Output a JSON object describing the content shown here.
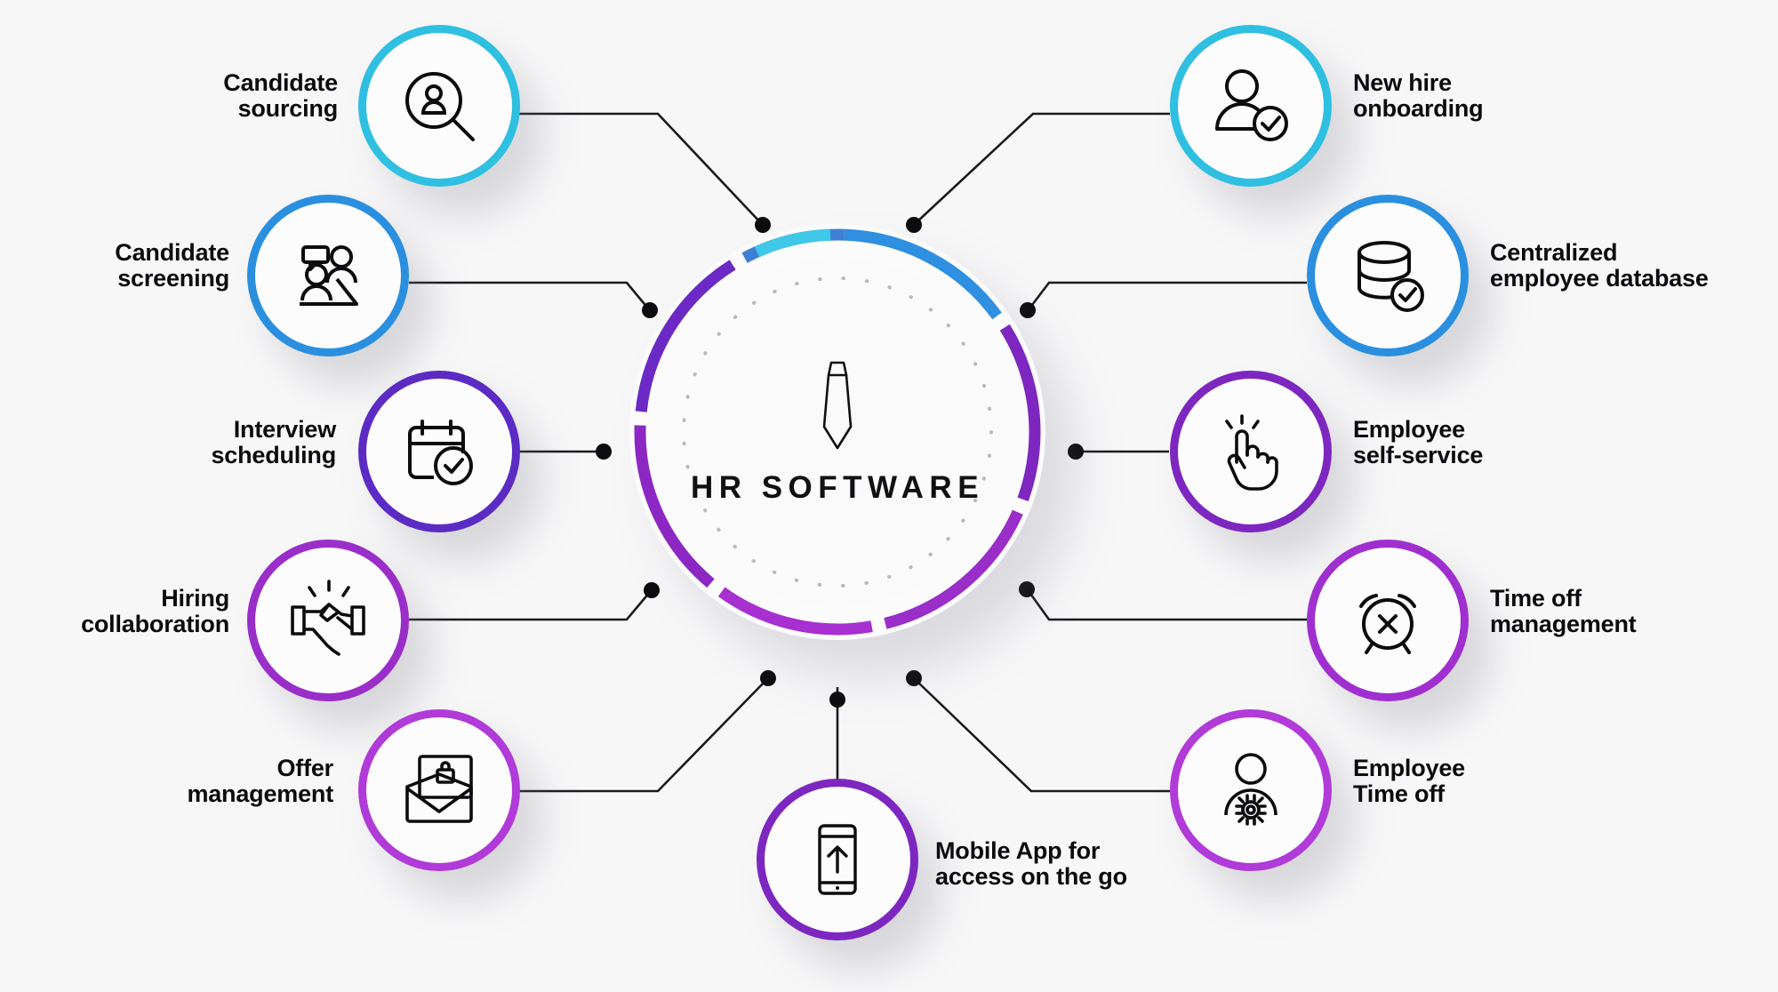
{
  "center": {
    "title": "HR SOFTWARE",
    "icon": "necktie-icon",
    "ring_colors": [
      "#3fc8e8",
      "#2f92e0",
      "#3f7fd6",
      "#5b2bc4",
      "#7d27c0",
      "#9a2ec9",
      "#b03bd8"
    ]
  },
  "palette": {
    "cyan": "#2fbfe0",
    "blue": "#2b8fe0",
    "indigo": "#3c79d0",
    "violet": "#5b2bc4",
    "purple": "#7d27c0",
    "magenta": "#a02fd0",
    "orchid": "#b03bd8",
    "line": "#1a1a1f",
    "text": "#0c0c0f",
    "background": "#f7f7f8"
  },
  "nodes": [
    {
      "id": "candidate-sourcing",
      "label": "Candidate\nsourcing",
      "icon": "person-search-icon",
      "color": "#2fbfe0",
      "side": "left"
    },
    {
      "id": "candidate-screening",
      "label": "Candidate\nscreening",
      "icon": "two-people-chat-icon",
      "color": "#2b8fe0",
      "side": "left"
    },
    {
      "id": "interview-scheduling",
      "label": "Interview\nscheduling",
      "icon": "calendar-check-icon",
      "color": "#5b2bc4",
      "side": "left"
    },
    {
      "id": "hiring-collaboration",
      "label": "Hiring\ncollaboration",
      "icon": "handshake-icon",
      "color": "#9a2ec9",
      "side": "left"
    },
    {
      "id": "offer-management",
      "label": "Offer\nmanagement",
      "icon": "envelope-briefcase-icon",
      "color": "#b03bd8",
      "side": "left"
    },
    {
      "id": "mobile-app",
      "label": "Mobile App for\naccess on the go",
      "icon": "mobile-upload-icon",
      "color": "#7d27c0",
      "side": "bottom"
    },
    {
      "id": "new-hire-onboarding",
      "label": "New hire\nonboarding",
      "icon": "person-check-icon",
      "color": "#2fbfe0",
      "side": "right"
    },
    {
      "id": "centralized-database",
      "label": "Centralized\nemployee database",
      "icon": "database-check-icon",
      "color": "#2b8fe0",
      "side": "right"
    },
    {
      "id": "employee-self-service",
      "label": "Employee\nself-service",
      "icon": "tap-hand-icon",
      "color": "#7d27c0",
      "side": "right"
    },
    {
      "id": "time-off-management",
      "label": "Time off\nmanagement",
      "icon": "alarm-x-icon",
      "color": "#a02fd0",
      "side": "right"
    },
    {
      "id": "employee-time-off",
      "label": "Employee\nTime off",
      "icon": "person-gear-icon",
      "color": "#b03bd8",
      "side": "right"
    }
  ],
  "chart_data": {
    "type": "diagram",
    "title": "HR SOFTWARE",
    "layout": "hub-and-spoke",
    "hub_label": "HR SOFTWARE",
    "spoke_count": 11,
    "spokes": [
      "Candidate sourcing",
      "Candidate screening",
      "Interview scheduling",
      "Hiring collaboration",
      "Offer management",
      "Mobile App for access on the go",
      "New hire onboarding",
      "Centralized employee database",
      "Employee self-service",
      "Time off management",
      "Employee Time off"
    ]
  }
}
